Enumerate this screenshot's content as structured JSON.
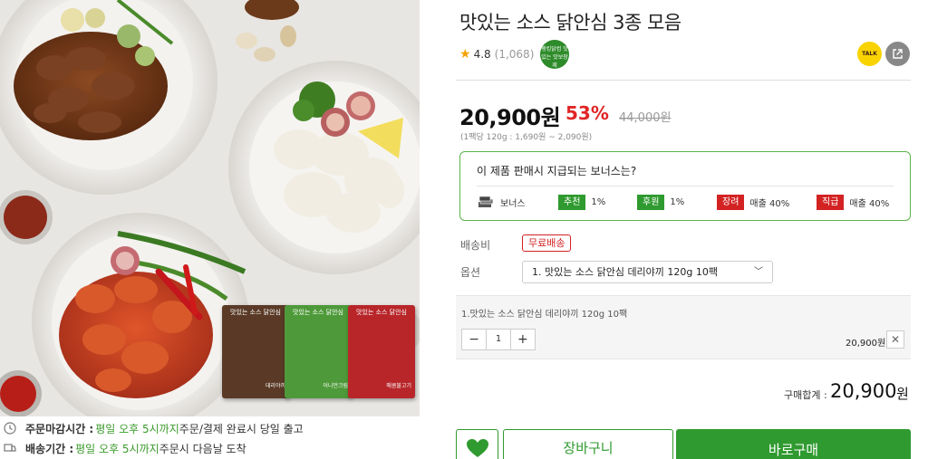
{
  "product": {
    "title": "맛있는 소스 닭안심 3종 모음",
    "rating": "4.8",
    "review_count": "(1,068)",
    "badge_text": "랭킹닭컴 맛있는 맛보장제",
    "kakao_label": "TALK",
    "price": "20,900원",
    "discount": "53%",
    "original_price": "44,000원",
    "unit_price": "(1팩당 120g : 1,690원 ~ 2,090원)"
  },
  "packages": [
    {
      "title": "맛있는 소스 닭안심",
      "name": "데리야끼",
      "color": "#5a3a26"
    },
    {
      "title": "맛있는 소스 닭안심",
      "name": "어니언크림",
      "color": "#4e9a3a"
    },
    {
      "title": "맛있는 소스 닭안심",
      "name": "매콤불고기",
      "color": "#b8262a"
    }
  ],
  "bonus": {
    "question": "이 제품 판매시 지급되는 보너스는?",
    "label": "보너스",
    "items": [
      {
        "tag": "추천",
        "value": "1%",
        "color": "#2f9a2f"
      },
      {
        "tag": "후원",
        "value": "1%",
        "color": "#2f9a2f"
      },
      {
        "tag": "장려",
        "value": "매출 40%",
        "color": "#d32222"
      },
      {
        "tag": "직급",
        "value": "매출 40%",
        "color": "#d32222"
      }
    ]
  },
  "shipping": {
    "label": "배송비",
    "value": "무료배송"
  },
  "option": {
    "label": "옵션",
    "selected": "1. 맛있는 소스 닭안심 데리야끼 120g 10팩"
  },
  "selected_item": {
    "name": "1.맛있는 소스 닭안심 데리야끼 120g 10팩",
    "quantity": "1",
    "minus": "−",
    "plus": "+",
    "price": "20,900원",
    "remove": "✕"
  },
  "total": {
    "label": "구매합계 :",
    "amount": "20,900",
    "unit": "원"
  },
  "buttons": {
    "cart": "장바구니",
    "buy": "바로구매"
  },
  "delivery_info": {
    "row1_label": "주문마감시간 :",
    "row1_value_green": "평일 오후 5시까지",
    "row1_value_rest": " 주문/결제 완료시 당일 출고",
    "row2_label": "배송기간 :",
    "row2_value_green": "평일 오후 5시까지",
    "row2_value_rest": " 주문시 다음날 도착"
  },
  "colors": {
    "accent": "#2f9a2f",
    "sale": "#e02626",
    "kakao": "#f9d300"
  }
}
